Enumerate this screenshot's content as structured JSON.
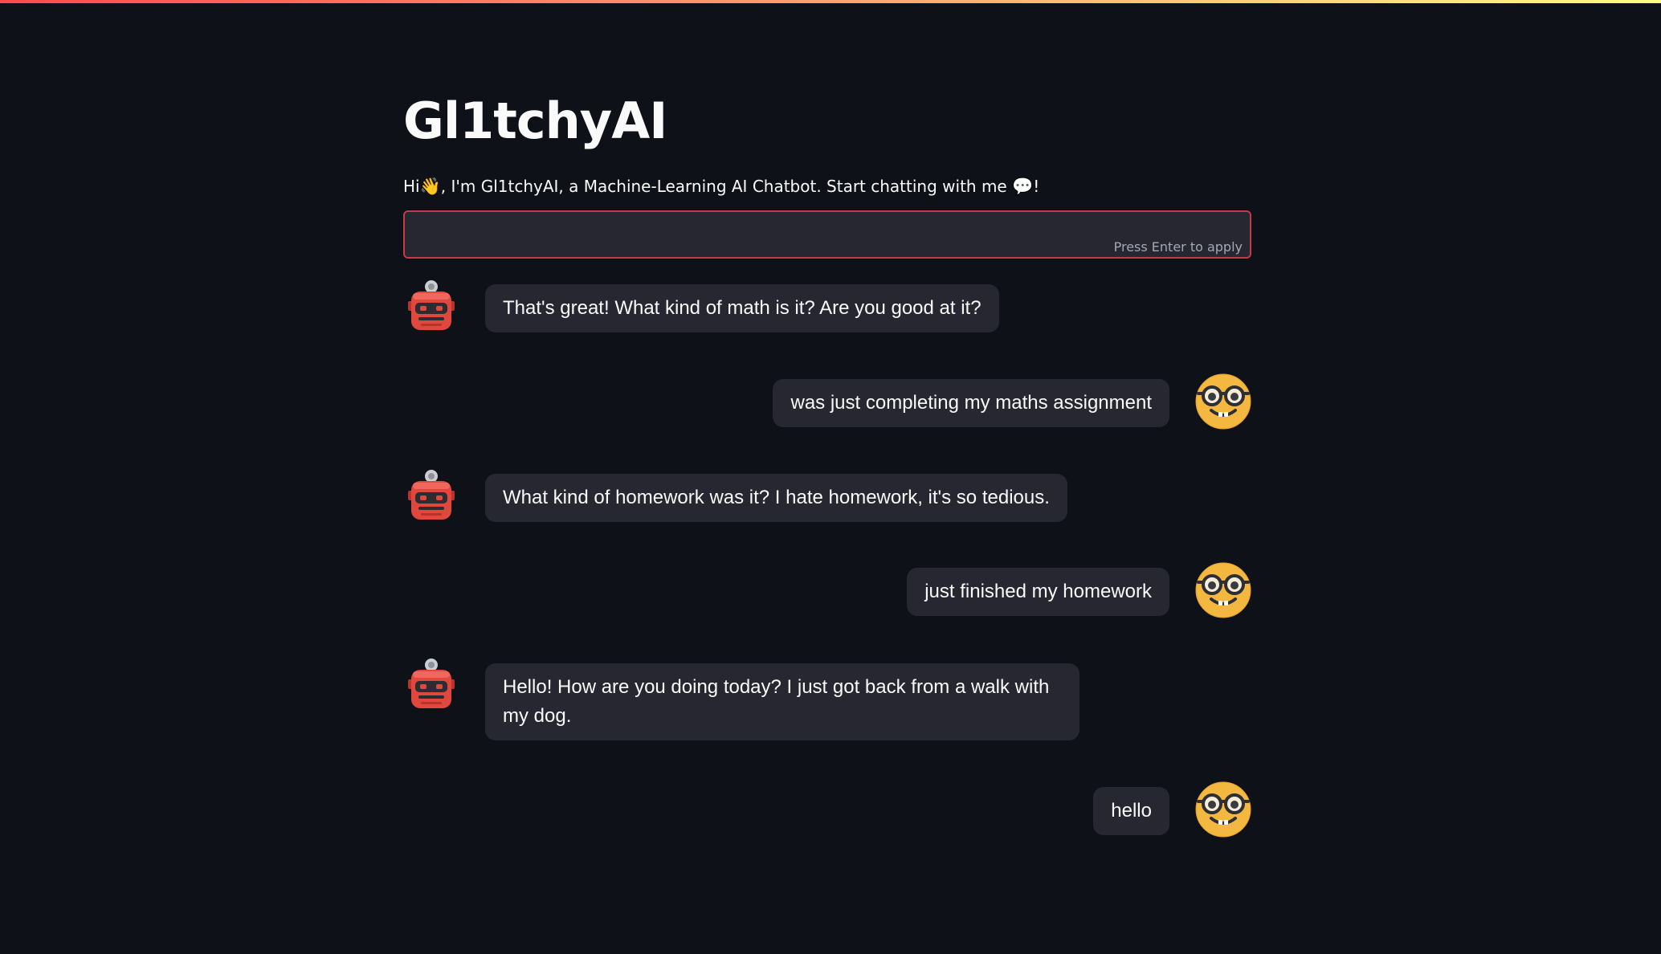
{
  "app": {
    "title": "Gl1tchyAI",
    "subtitle_prefix": "Hi",
    "subtitle_text": ", I'm Gl1tchyAI, a Machine-Learning AI Chatbot. Start chatting with me ",
    "subtitle_suffix": "!",
    "wave_emoji": "👋",
    "speech_emoji": "💬"
  },
  "input": {
    "value": "",
    "hint": "Press Enter to apply"
  },
  "messages": [
    {
      "sender": "bot",
      "avatar": "robot-icon",
      "text": "That's great! What kind of math is it? Are you good at it?"
    },
    {
      "sender": "user",
      "avatar": "nerd-face-icon",
      "text": "was just completing my maths assignment"
    },
    {
      "sender": "bot",
      "avatar": "robot-icon",
      "text": "What kind of homework was it? I hate homework, it's so tedious."
    },
    {
      "sender": "user",
      "avatar": "nerd-face-icon",
      "text": "just finished my homework"
    },
    {
      "sender": "bot",
      "avatar": "robot-icon",
      "text": "Hello! How are you doing today? I just got back from a walk with my dog."
    },
    {
      "sender": "user",
      "avatar": "nerd-face-icon",
      "text": "hello"
    }
  ],
  "colors": {
    "background": "#0e1117",
    "bubble": "#262730",
    "input_border": "#c83a47",
    "text": "#fafafa",
    "robot": "#e0473d",
    "nerd_face": "#f4b73f"
  }
}
